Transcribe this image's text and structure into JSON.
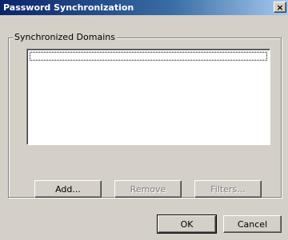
{
  "window": {
    "title": "Password Synchronization",
    "close_symbol": "×"
  },
  "group": {
    "label": "Synchronized Domains",
    "items": []
  },
  "buttons": {
    "add": "Add...",
    "remove": "Remove",
    "filters": "Filters...",
    "ok": "OK",
    "cancel": "Cancel"
  },
  "icons": {
    "close": "close-icon"
  },
  "colors": {
    "titlebar_start": "#0a246a",
    "titlebar_end": "#a6caf0",
    "face": "#d4d0c8"
  }
}
